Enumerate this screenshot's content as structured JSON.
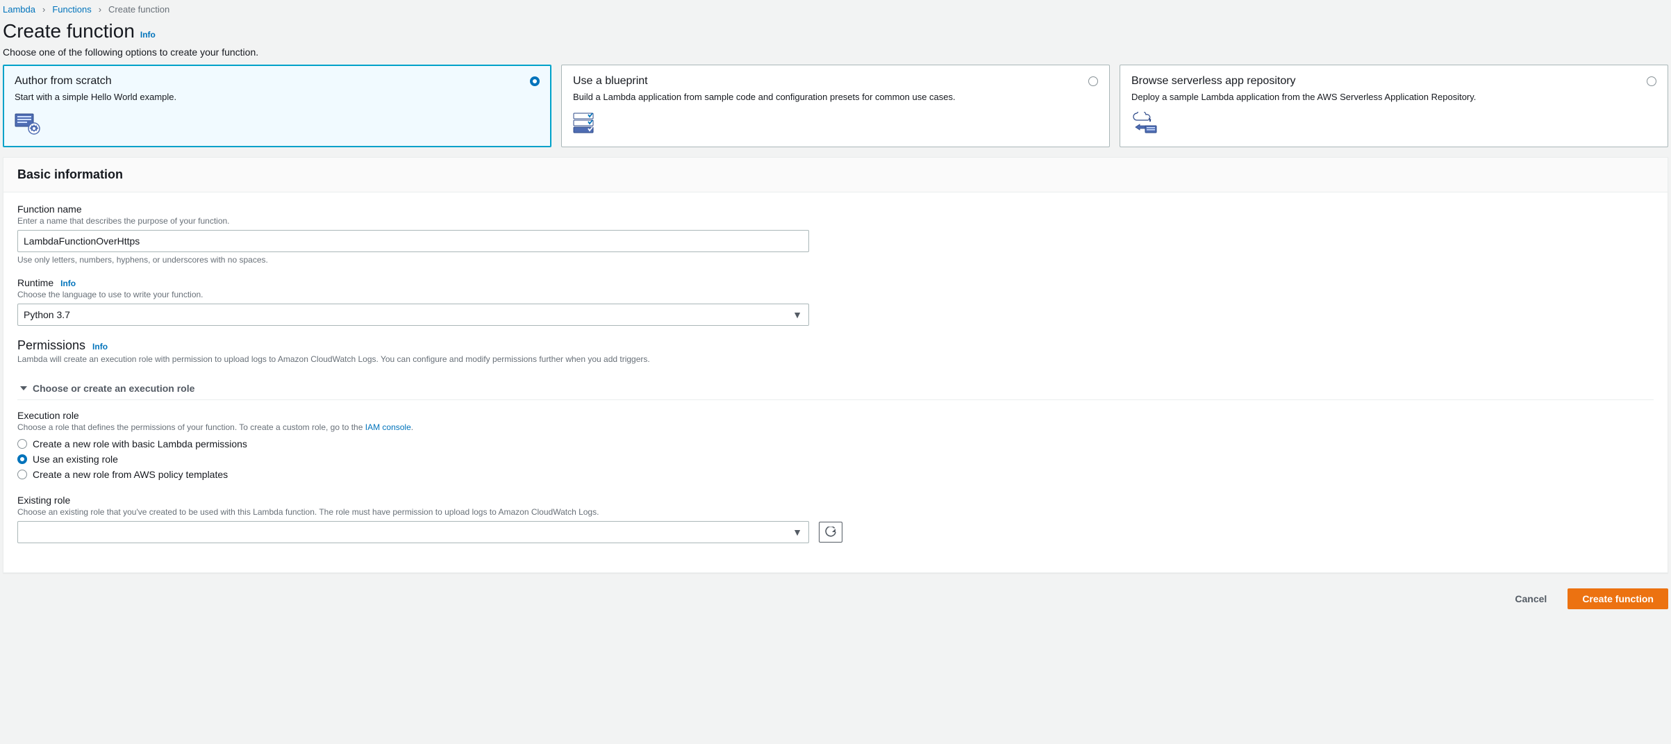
{
  "breadcrumb": {
    "items": [
      "Lambda",
      "Functions",
      "Create function"
    ]
  },
  "header": {
    "title": "Create function",
    "info": "Info",
    "subtitle": "Choose one of the following options to create your function."
  },
  "options": [
    {
      "title": "Author from scratch",
      "desc": "Start with a simple Hello World example.",
      "selected": true
    },
    {
      "title": "Use a blueprint",
      "desc": "Build a Lambda application from sample code and configuration presets for common use cases.",
      "selected": false
    },
    {
      "title": "Browse serverless app repository",
      "desc": "Deploy a sample Lambda application from the AWS Serverless Application Repository.",
      "selected": false
    }
  ],
  "basic": {
    "panelTitle": "Basic information",
    "functionName": {
      "label": "Function name",
      "hint": "Enter a name that describes the purpose of your function.",
      "value": "LambdaFunctionOverHttps",
      "constraint": "Use only letters, numbers, hyphens, or underscores with no spaces."
    },
    "runtime": {
      "label": "Runtime",
      "info": "Info",
      "hint": "Choose the language to use to write your function.",
      "value": "Python 3.7"
    }
  },
  "permissions": {
    "label": "Permissions",
    "info": "Info",
    "desc": "Lambda will create an execution role with permission to upload logs to Amazon CloudWatch Logs. You can configure and modify permissions further when you add triggers.",
    "expander": "Choose or create an execution role",
    "executionRole": {
      "label": "Execution role",
      "hintPrefix": "Choose a role that defines the permissions of your function. To create a custom role, go to the ",
      "iamLink": "IAM console",
      "hintSuffix": ".",
      "options": [
        {
          "label": "Create a new role with basic Lambda permissions",
          "checked": false
        },
        {
          "label": "Use an existing role",
          "checked": true
        },
        {
          "label": "Create a new role from AWS policy templates",
          "checked": false
        }
      ]
    },
    "existingRole": {
      "label": "Existing role",
      "hint": "Choose an existing role that you've created to be used with this Lambda function. The role must have permission to upload logs to Amazon CloudWatch Logs.",
      "value": ""
    }
  },
  "footer": {
    "cancel": "Cancel",
    "create": "Create function"
  }
}
